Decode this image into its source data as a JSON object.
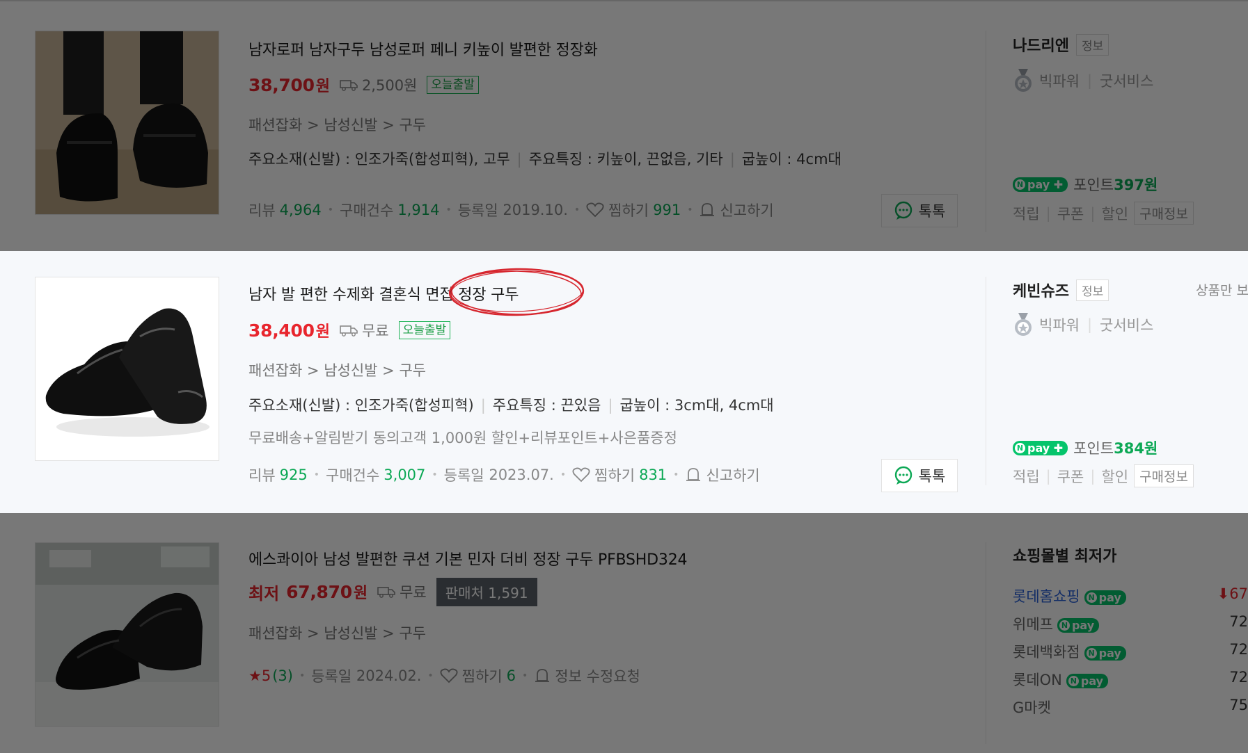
{
  "products": [
    {
      "title": "남자로퍼 남자구두 남성로퍼 페니 키높이 발편한 정장화",
      "price": "38,700",
      "won": "원",
      "shipping": "2,500원",
      "badge": "오늘출발",
      "category": "패션잡화 > 남성신발 > 구두",
      "attrs": [
        "주요소재(신발) : 인조가죽(합성피혁), 고무",
        "주요특징 : 키높이, 끈없음, 기타",
        "굽높이 : 4cm대"
      ],
      "review_label": "리뷰",
      "review_count": "4,964",
      "purchase_label": "구매건수",
      "purchase_count": "1,914",
      "reg_label": "등록일",
      "reg_date": "2019.10.",
      "wish_label": "찜하기",
      "wish_count": "991",
      "report_label": "신고하기",
      "talk_label": "톡톡",
      "mall": {
        "name": "나드리엔",
        "info": "정보",
        "power": "빅파워",
        "service": "굿서비스",
        "point_label": "포인트",
        "point": "397원",
        "benefits": [
          "적립",
          "쿠폰",
          "할인"
        ],
        "purchase_info": "구매정보"
      }
    },
    {
      "title": "남자 발 편한 수제화 결혼식 면접 정장 구두",
      "price": "38,400",
      "won": "원",
      "shipping": "무료",
      "badge": "오늘출발",
      "category": "패션잡화 > 남성신발 > 구두",
      "attrs": [
        "주요소재(신발) : 인조가죽(합성피혁)",
        "주요특징 : 끈있음",
        "굽높이 : 3cm대, 4cm대"
      ],
      "promo": "무료배송+알림받기 동의고객 1,000원 할인+리뷰포인트+사은품증정",
      "review_label": "리뷰",
      "review_count": "925",
      "purchase_label": "구매건수",
      "purchase_count": "3,007",
      "reg_label": "등록일",
      "reg_date": "2023.07.",
      "wish_label": "찜하기",
      "wish_count": "831",
      "report_label": "신고하기",
      "talk_label": "톡톡",
      "side_text": "상품만 보",
      "mall": {
        "name": "케빈슈즈",
        "info": "정보",
        "power": "빅파워",
        "service": "굿서비스",
        "point_label": "포인트",
        "point": "384원",
        "benefits": [
          "적립",
          "쿠폰",
          "할인"
        ],
        "purchase_info": "구매정보"
      }
    },
    {
      "title": "에스콰이아 남성 발편한 쿠션 기본 민자 더비 정장 구두 PFBSHD324",
      "low_label": "최저",
      "price": "67,870",
      "won": "원",
      "shipping": "무료",
      "seller_badge": "판매처 1,591",
      "category": "패션잡화 > 남성신발 > 구두",
      "rating": "★5",
      "rating_count": "(3)",
      "reg_label": "등록일",
      "reg_date": "2024.02.",
      "wish_label": "찜하기",
      "wish_count": "6",
      "report_label": "정보 수정요청",
      "lowest_title": "쇼핑몰별 최저가",
      "shops": [
        {
          "name": "롯데홈쇼핑",
          "npay": "pay",
          "price": "⬇67"
        },
        {
          "name": "위메프",
          "npay": "pay",
          "price": "72"
        },
        {
          "name": "롯데백화점",
          "npay": "pay",
          "price": "72"
        },
        {
          "name": "롯데ON",
          "npay": "pay",
          "price": "72"
        },
        {
          "name": "G마켓",
          "npay": "",
          "price": "75"
        }
      ]
    }
  ],
  "npay_label": "pay",
  "colors": {
    "price": "#e8252d",
    "green": "#0ca855",
    "npay": "#05c46b",
    "highlight": "#d6262e",
    "overlay": "rgba(0,0,0,0.53)"
  }
}
